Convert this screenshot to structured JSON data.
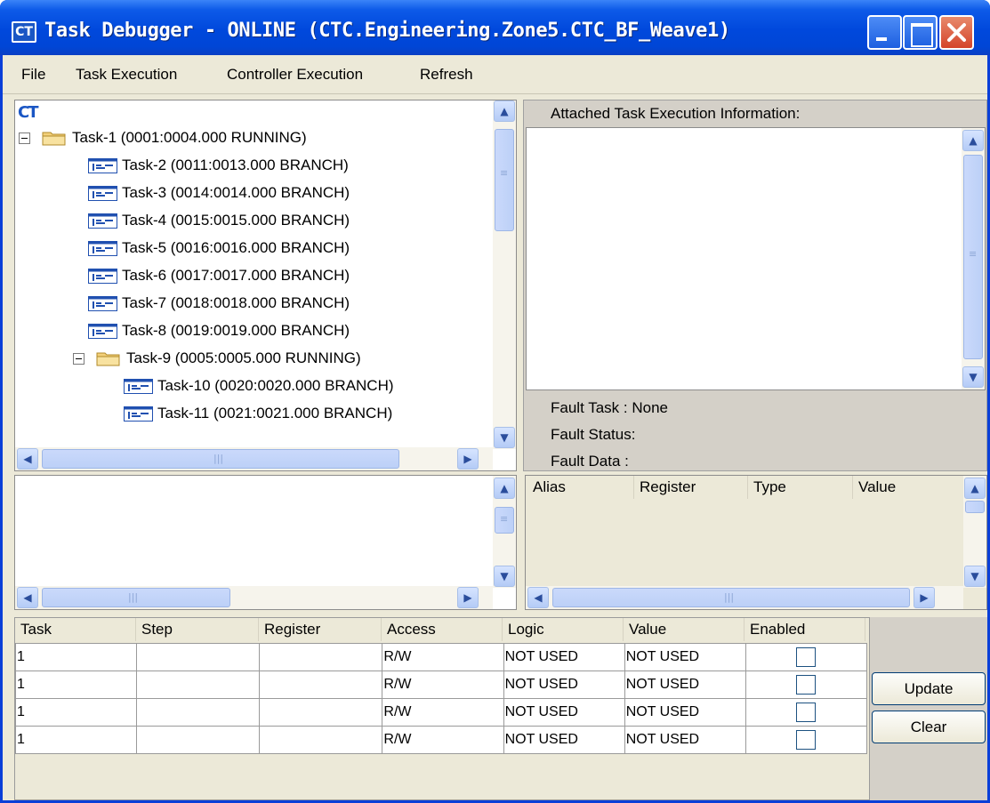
{
  "window": {
    "title": "Task Debugger - ONLINE (CTC.Engineering.Zone5.CTC_BF_Weave1)",
    "app_icon_text": "CT"
  },
  "menu": [
    "File",
    "Task Execution",
    "Controller Execution",
    "Refresh"
  ],
  "tree": {
    "logo": "CT",
    "items": [
      {
        "label": "Task-1 (0001:0004.000 RUNNING)",
        "type": "folder",
        "level": 0
      },
      {
        "label": "Task-2 (0011:0013.000 BRANCH)",
        "type": "task",
        "level": 1
      },
      {
        "label": "Task-3 (0014:0014.000 BRANCH)",
        "type": "task",
        "level": 1
      },
      {
        "label": "Task-4 (0015:0015.000 BRANCH)",
        "type": "task",
        "level": 1
      },
      {
        "label": "Task-5 (0016:0016.000 BRANCH)",
        "type": "task",
        "level": 1
      },
      {
        "label": "Task-6 (0017:0017.000 BRANCH)",
        "type": "task",
        "level": 1
      },
      {
        "label": "Task-7 (0018:0018.000 BRANCH)",
        "type": "task",
        "level": 1
      },
      {
        "label": "Task-8 (0019:0019.000 BRANCH)",
        "type": "task",
        "level": 1
      },
      {
        "label": "Task-9 (0005:0005.000 RUNNING)",
        "type": "folder",
        "level": 1
      },
      {
        "label": "Task-10 (0020:0020.000 BRANCH)",
        "type": "task",
        "level": 2
      },
      {
        "label": "Task-11 (0021:0021.000 BRANCH)",
        "type": "task",
        "level": 2
      }
    ]
  },
  "attached": {
    "header": "Attached Task Execution Information:"
  },
  "fault": {
    "task": "Fault Task : None",
    "status": "Fault Status:",
    "data": "Fault Data :"
  },
  "alias_table": {
    "columns": [
      "Alias",
      "Register",
      "Type",
      "Value"
    ]
  },
  "watch_table": {
    "columns": [
      "Task",
      "Step",
      "Register",
      "Access",
      "Logic",
      "Value",
      "Enabled"
    ],
    "rows": [
      {
        "task": "1",
        "step": "",
        "register": "",
        "access": "R/W",
        "logic": "NOT USED",
        "value": "NOT USED",
        "enabled": false
      },
      {
        "task": "1",
        "step": "",
        "register": "",
        "access": "R/W",
        "logic": "NOT USED",
        "value": "NOT USED",
        "enabled": false
      },
      {
        "task": "1",
        "step": "",
        "register": "",
        "access": "R/W",
        "logic": "NOT USED",
        "value": "NOT USED",
        "enabled": false
      },
      {
        "task": "1",
        "step": "",
        "register": "",
        "access": "R/W",
        "logic": "NOT USED",
        "value": "NOT USED",
        "enabled": false
      }
    ]
  },
  "buttons": {
    "update": "Update",
    "clear": "Clear"
  },
  "icons": [
    "app-icon",
    "minimize-icon",
    "maximize-icon",
    "close-icon",
    "expander-minus-icon",
    "folder-icon",
    "task-icon",
    "ct-logo-icon",
    "scroll-up-icon",
    "scroll-down-icon",
    "scroll-left-icon",
    "scroll-right-icon"
  ],
  "colors": {
    "title_bar": "#0048dc",
    "client_bg": "#ece9d8",
    "close_button": "#d4442a"
  }
}
